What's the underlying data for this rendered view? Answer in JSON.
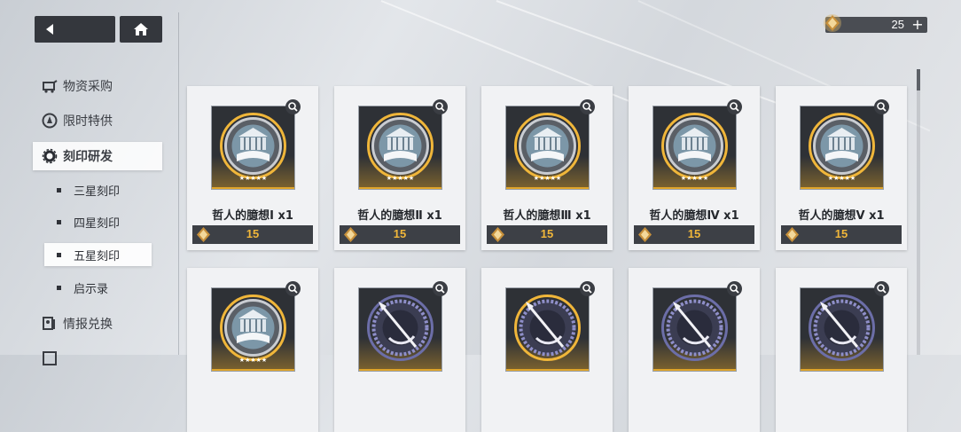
{
  "nav": {
    "back_icon": "back-arrow-icon",
    "home_icon": "home-icon"
  },
  "currency": {
    "icon": "gem-icon",
    "amount": "25",
    "plus": "+"
  },
  "sidebar": {
    "items": [
      {
        "label": "物资采购",
        "icon": "cart-icon"
      },
      {
        "label": "限时特供",
        "icon": "badge-icon"
      },
      {
        "label": "刻印研发",
        "icon": "gear-icon"
      },
      {
        "label": "情报兑换",
        "icon": "intel-icon"
      }
    ],
    "sub_items": [
      {
        "label": "三星刻印"
      },
      {
        "label": "四星刻印"
      },
      {
        "label": "五星刻印"
      },
      {
        "label": "启示录"
      }
    ]
  },
  "cards": [
    {
      "name": "哲人的臆想Ⅰ x1",
      "price": "15",
      "emblem": "philosopher-emblem"
    },
    {
      "name": "哲人的臆想Ⅱ x1",
      "price": "15",
      "emblem": "philosopher-emblem"
    },
    {
      "name": "哲人的臆想Ⅲ x1",
      "price": "15",
      "emblem": "philosopher-emblem"
    },
    {
      "name": "哲人的臆想Ⅳ x1",
      "price": "15",
      "emblem": "philosopher-emblem"
    },
    {
      "name": "哲人的臆想Ⅴ x1",
      "price": "15",
      "emblem": "philosopher-emblem"
    },
    {
      "name": "",
      "price": "",
      "emblem": "philosopher-emblem"
    },
    {
      "name": "",
      "price": "",
      "emblem": "spear-emblem"
    },
    {
      "name": "",
      "price": "",
      "emblem": "spear-emblem"
    },
    {
      "name": "",
      "price": "",
      "emblem": "spear-emblem"
    },
    {
      "name": "",
      "price": "",
      "emblem": "spear-emblem"
    }
  ],
  "colors": {
    "accent_gold": "#f0b63a",
    "panel_dark": "#34373d"
  }
}
